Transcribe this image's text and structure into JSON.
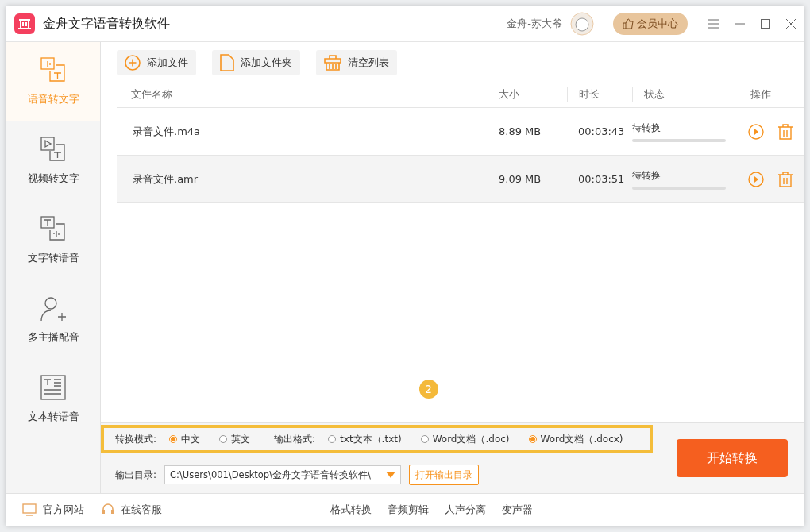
{
  "window": {
    "title": "金舟文字语音转换软件",
    "user": "金舟-苏大爷",
    "vip_button": "会员中心"
  },
  "sidebar": {
    "items": [
      {
        "label": "语音转文字",
        "kind": "speech",
        "selected": true
      },
      {
        "label": "视频转文字",
        "kind": "video",
        "selected": false
      },
      {
        "label": "文字转语音",
        "kind": "tts",
        "selected": false
      },
      {
        "label": "多主播配音",
        "kind": "person",
        "selected": false
      },
      {
        "label": "文本转语音",
        "kind": "doc",
        "selected": false
      }
    ]
  },
  "toolbar": [
    {
      "label": "添加文件",
      "kind": "add"
    },
    {
      "label": "添加文件夹",
      "kind": "folder"
    },
    {
      "label": "清空列表",
      "kind": "clear"
    }
  ],
  "table": {
    "columns": [
      "文件名称",
      "大小",
      "时长",
      "状态",
      "操作"
    ],
    "rows": [
      {
        "name": "录音文件.m4a",
        "size": "8.89 MB",
        "duration": "00:03:43",
        "status": "待转换",
        "level": 0
      },
      {
        "name": "录音文件.amr",
        "size": "9.09 MB",
        "duration": "00:03:51",
        "status": "待转换",
        "level": 0
      }
    ]
  },
  "step_badge": "2",
  "options": {
    "mode_label": "转换模式:",
    "modes": [
      {
        "label": "中文",
        "selected": true
      },
      {
        "label": "英文",
        "selected": false
      }
    ],
    "format_label": "输出格式:",
    "formats": [
      {
        "label": "txt文本（.txt)",
        "selected": false
      },
      {
        "label": "Word文档（.doc)",
        "selected": false
      },
      {
        "label": "Word文档（.docx)",
        "selected": true
      }
    ],
    "output_label": "输出目录:",
    "output_path": "C:\\Users\\001\\Desktop\\金舟文字语音转换软件\\",
    "open_button": "打开输出目录",
    "start_button": "开始转换"
  },
  "footer": {
    "left": [
      {
        "label": "官方网站",
        "kind": "web"
      },
      {
        "label": "在线客服",
        "kind": "support"
      }
    ],
    "links": [
      "格式转换",
      "音频剪辑",
      "人声分离",
      "变声器"
    ]
  }
}
